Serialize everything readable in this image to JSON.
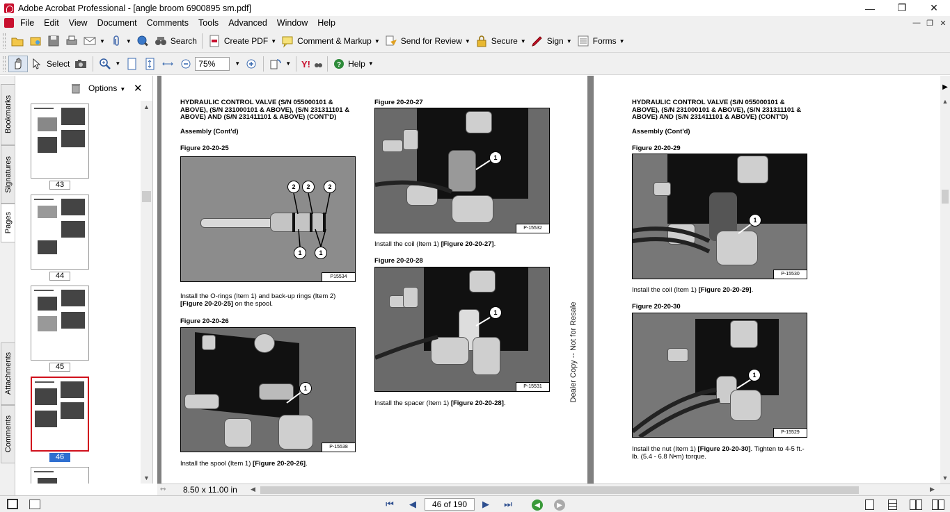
{
  "window": {
    "title": "Adobe Acrobat Professional - [angle broom 6900895 sm.pdf]",
    "minimize": "—",
    "restore": "❐",
    "close": "✕"
  },
  "menu": [
    "File",
    "Edit",
    "View",
    "Document",
    "Comments",
    "Tools",
    "Advanced",
    "Window",
    "Help"
  ],
  "doc_controls": {
    "min": "—",
    "restore": "❐",
    "close": "✕"
  },
  "toolbar1": {
    "search": "Search",
    "create_pdf": "Create PDF",
    "comment_markup": "Comment & Markup",
    "send_for_review": "Send for Review",
    "secure": "Secure",
    "sign": "Sign",
    "forms": "Forms"
  },
  "toolbar2": {
    "select": "Select",
    "zoom_value": "75%",
    "help": "Help"
  },
  "nav_tabs": [
    "Bookmarks",
    "Signatures",
    "Pages",
    "Attachments",
    "Comments"
  ],
  "thumbnails": {
    "options": "Options",
    "pages": [
      {
        "num": "43",
        "selected": false
      },
      {
        "num": "44",
        "selected": false
      },
      {
        "num": "45",
        "selected": false
      },
      {
        "num": "46",
        "selected": true
      }
    ]
  },
  "left_page": {
    "header": "HYDRAULIC CONTROL VALVE (S/N 055000101 & ABOVE), (S/N 231000101 & ABOVE), (S/N 231311101 & ABOVE) AND (S/N 231411101 & ABOVE) (CONT'D)",
    "section": "Assembly (Cont'd)",
    "fig25_caption": "Figure 20-20-25",
    "fig25_tag": "P15534",
    "fig25_text_a": "Install the O-rings (Item 1) and back-up rings (Item 2)",
    "fig25_text_b_ref": "[Figure 20-20-25]",
    "fig25_text_b_tail": " on the spool.",
    "fig26_caption": "Figure 20-20-26",
    "fig26_tag": "P-15538",
    "fig26_text_a": "Install the spool (Item 1) ",
    "fig26_text_ref": "[Figure 20-20-26]",
    "fig26_text_tail": ".",
    "fig27_caption": "Figure 20-20-27",
    "fig27_tag": "P-15532",
    "fig27_text_a": "Install the coil (Item 1) ",
    "fig27_text_ref": "[Figure 20-20-27]",
    "fig27_text_tail": ".",
    "fig28_caption": "Figure 20-20-28",
    "fig28_tag": "P-15531",
    "fig28_text_a": "Install the spacer (Item 1) ",
    "fig28_text_ref": "[Figure 20-20-28]",
    "fig28_text_tail": ".",
    "watermark": "Dealer Copy -- Not for Resale"
  },
  "right_page": {
    "header": "HYDRAULIC CONTROL VALVE (S/N 055000101 & ABOVE), (S/N 231000101 & ABOVE), (S/N 231311101 & ABOVE) AND (S/N 231411101 & ABOVE) (CONT'D)",
    "section": "Assembly (Cont'd)",
    "fig29_caption": "Figure 20-20-29",
    "fig29_tag": "P-15530",
    "fig29_text_a": "Install the coil (Item 1) ",
    "fig29_text_ref": "[Figure 20-20-29]",
    "fig29_text_tail": ".",
    "fig30_caption": "Figure 20-20-30",
    "fig30_tag": "P-15529",
    "fig30_text_a": "Install the nut (Item 1) ",
    "fig30_text_ref": "[Figure 20-20-30]",
    "fig30_text_tail": ". Tighten to 4-5 ft.-lb. (5.4 - 6.8 N•m) torque."
  },
  "callouts": {
    "one": "1",
    "two": "2"
  },
  "status": {
    "page_size": "8.50 x 11.00 in"
  },
  "bottom": {
    "page_indicator": "46 of 190"
  }
}
